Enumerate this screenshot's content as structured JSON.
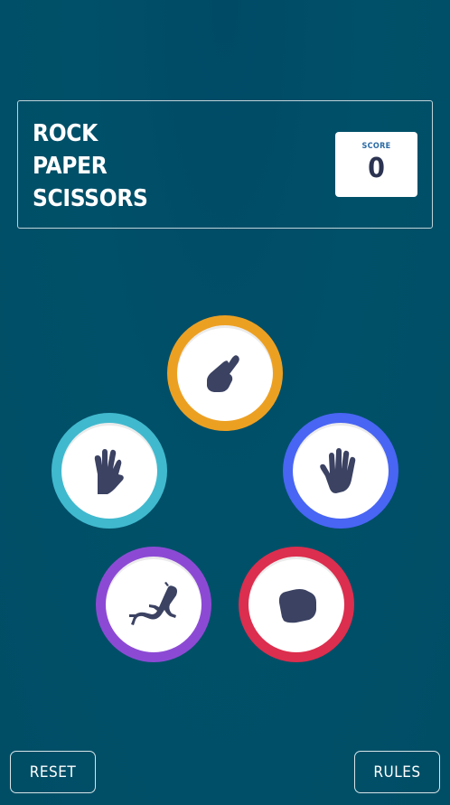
{
  "header": {
    "title_lines": [
      "ROCK",
      "PAPER",
      "SCISSORS"
    ],
    "score_label": "SCORE",
    "score_value": "0"
  },
  "tokens": [
    {
      "name": "scissors",
      "icon": "scissors-hand-icon",
      "ring_color": "#eca022"
    },
    {
      "name": "spock",
      "icon": "spock-hand-icon",
      "ring_color": "#40b9ce"
    },
    {
      "name": "paper",
      "icon": "open-hand-icon",
      "ring_color": "#4865f4"
    },
    {
      "name": "lizard",
      "icon": "lizard-icon",
      "ring_color": "#8c4ad4"
    },
    {
      "name": "rock",
      "icon": "fist-icon",
      "ring_color": "#dc2e4e"
    }
  ],
  "icon_color": "#3b4262",
  "buttons": {
    "reset": "RESET",
    "rules": "RULES"
  }
}
